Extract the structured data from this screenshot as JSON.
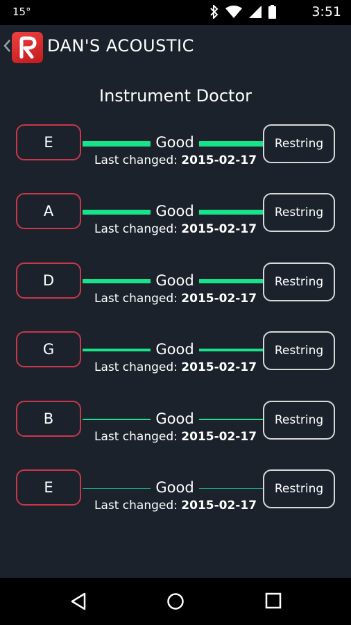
{
  "status_bar": {
    "temperature": "15°",
    "time": "3:51"
  },
  "app_bar": {
    "title": "DAN'S ACOUSTIC",
    "logo_color": "#e02a2e"
  },
  "page_title": "Instrument Doctor",
  "colors": {
    "accent": "#18e38a",
    "string_border": "#c9374a",
    "background": "#1b222c"
  },
  "strings": [
    {
      "note": "E",
      "status": "Good",
      "changed_label": "Last changed:",
      "changed_date": "2015-02-17",
      "action": "Restring",
      "health": 1.0
    },
    {
      "note": "A",
      "status": "Good",
      "changed_label": "Last changed:",
      "changed_date": "2015-02-17",
      "action": "Restring",
      "health": 0.9
    },
    {
      "note": "D",
      "status": "Good",
      "changed_label": "Last changed:",
      "changed_date": "2015-02-17",
      "action": "Restring",
      "health": 0.8
    },
    {
      "note": "G",
      "status": "Good",
      "changed_label": "Last changed:",
      "changed_date": "2015-02-17",
      "action": "Restring",
      "health": 0.6
    },
    {
      "note": "B",
      "status": "Good",
      "changed_label": "Last changed:",
      "changed_date": "2015-02-17",
      "action": "Restring",
      "health": 0.4
    },
    {
      "note": "E",
      "status": "Good",
      "changed_label": "Last changed:",
      "changed_date": "2015-02-17",
      "action": "Restring",
      "health": 0.2
    }
  ]
}
